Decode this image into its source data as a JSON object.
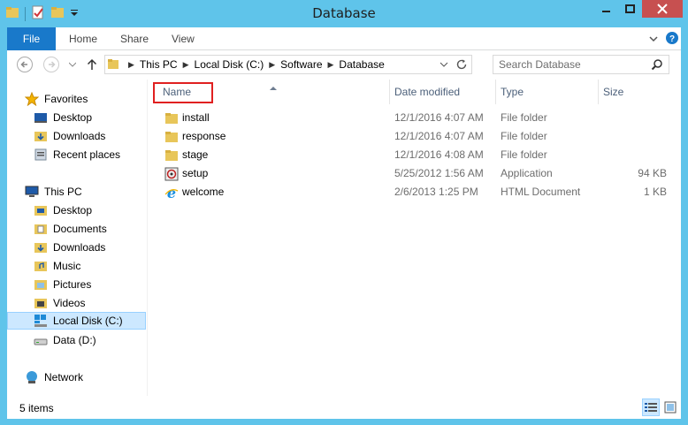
{
  "window": {
    "title": "Database"
  },
  "ribbon": {
    "tabs": [
      "File",
      "Home",
      "Share",
      "View"
    ]
  },
  "address": {
    "crumbs": [
      "This PC",
      "Local Disk (C:)",
      "Software",
      "Database"
    ],
    "search_placeholder": "Search Database"
  },
  "nav": {
    "favorites": {
      "label": "Favorites",
      "items": [
        "Desktop",
        "Downloads",
        "Recent places"
      ]
    },
    "thispc": {
      "label": "This PC",
      "items": [
        "Desktop",
        "Documents",
        "Downloads",
        "Music",
        "Pictures",
        "Videos",
        "Local Disk (C:)",
        "Data (D:)"
      ]
    },
    "network": {
      "label": "Network"
    }
  },
  "columns": {
    "name": "Name",
    "date": "Date modified",
    "type": "Type",
    "size": "Size"
  },
  "files": [
    {
      "name": "install",
      "date": "12/1/2016 4:07 AM",
      "type": "File folder",
      "size": "",
      "icon": "folder-icon"
    },
    {
      "name": "response",
      "date": "12/1/2016 4:07 AM",
      "type": "File folder",
      "size": "",
      "icon": "folder-icon"
    },
    {
      "name": "stage",
      "date": "12/1/2016 4:08 AM",
      "type": "File folder",
      "size": "",
      "icon": "folder-icon"
    },
    {
      "name": "setup",
      "date": "5/25/2012 1:56 AM",
      "type": "Application",
      "size": "94 KB",
      "icon": "application-icon"
    },
    {
      "name": "welcome",
      "date": "2/6/2013 1:25 PM",
      "type": "HTML Document",
      "size": "1 KB",
      "icon": "internet-explorer-icon"
    }
  ],
  "status": {
    "count": "5 items"
  },
  "colors": {
    "frame": "#5fc4ea",
    "file_tab": "#1979ca",
    "selection": "#cce8ff",
    "highlight": "#e02020",
    "close": "#c75050"
  }
}
